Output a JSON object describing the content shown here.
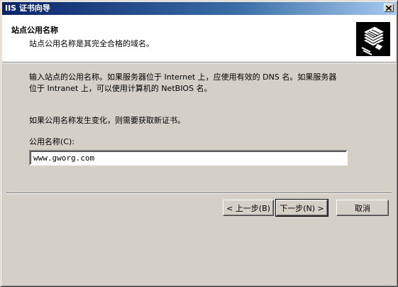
{
  "window": {
    "title": "IIS 证书向导"
  },
  "header": {
    "title": "站点公用名称",
    "subtitle": "站点公用名称是其完全合格的域名。",
    "icon": "certificate-wizard-icon"
  },
  "body": {
    "instruction_line1": "输入站点的公用名称。如果服务器位于 Internet 上，应使用有效的 DNS 名。如果服务器",
    "instruction_line2": "位于 Intranet 上，可以使用计算机的 NetBIOS 名。",
    "note": "如果公用名称发生变化，则需要获取新证书。",
    "common_name_label": "公用名称(C):",
    "common_name_value": "www.gworg.com"
  },
  "buttons": {
    "back": "< 上一步(B)",
    "next": "下一步(N) >",
    "cancel": "取消"
  }
}
